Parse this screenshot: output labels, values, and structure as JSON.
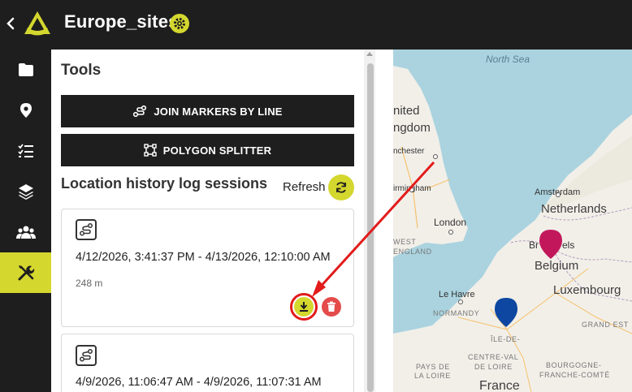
{
  "header": {
    "title": "Europe_sites",
    "accent": "#d4d72e",
    "background": "#1e1e1e"
  },
  "sidenav": {
    "items": [
      {
        "name": "folder-icon",
        "active": false
      },
      {
        "name": "location-pin-icon",
        "active": false
      },
      {
        "name": "checklist-icon",
        "active": false
      },
      {
        "name": "layers-icon",
        "active": false
      },
      {
        "name": "users-icon",
        "active": false
      },
      {
        "name": "tools-icon",
        "active": true
      }
    ]
  },
  "tools": {
    "heading": "Tools",
    "join_label": "JOIN MARKERS BY LINE",
    "polygon_label": "POLYGON SPLITTER"
  },
  "sessions": {
    "heading": "Location history log sessions",
    "refresh_label": "Refresh",
    "items": [
      {
        "range": "4/12/2026, 3:41:37 PM - 4/13/2026, 12:10:00 AM",
        "distance": "248 m"
      },
      {
        "range": "4/9/2026, 11:06:47 AM - 4/9/2026, 11:07:31 AM"
      }
    ]
  },
  "map": {
    "sea": "North Sea",
    "labels": {
      "uk1": "nited",
      "uk2": "ngdom",
      "manchester": "nchester",
      "birmingham": "irmingham",
      "london": "London",
      "amsterdam": "Amsterdam",
      "netherlands": "Netherlands",
      "brussels": "Br",
      "brussels2": "els",
      "belgium": "Belgium",
      "luxembourg": "Luxembourg",
      "lehavre": "Le Havre",
      "west": "WEST",
      "england": "ENGLAND",
      "normandy": "NORMANDY",
      "grandest": "GRAND EST",
      "ile": "ÎLE-DE-",
      "centre1": "CENTRE-VAL",
      "centre2": "DE LOIRE",
      "pays1": "PAYS DE",
      "pays2": "LA LOIRE",
      "bourg1": "BOURGOGNE-",
      "bourg2": "FRANCHE-COMTÉ",
      "france": "France"
    },
    "marker_colors": {
      "brussels": "#c2185b",
      "paris": "#0d47a1"
    }
  },
  "annotation": {
    "arrow_color": "#e21b1b"
  }
}
